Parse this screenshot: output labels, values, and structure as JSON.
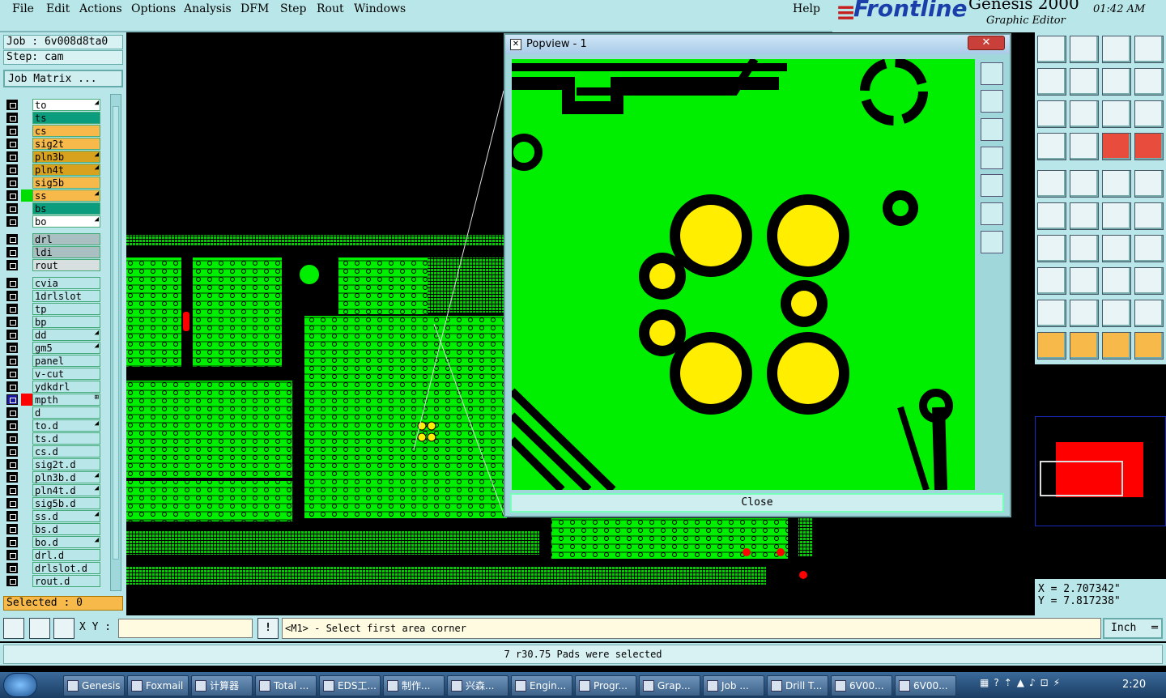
{
  "menubar": {
    "items": [
      "File",
      "Edit",
      "Actions",
      "Options",
      "Analysis",
      "DFM",
      "Step",
      "Rout",
      "Windows"
    ],
    "help": "Help"
  },
  "logo": {
    "brand": "Frontline",
    "product": "Genesis 2000",
    "subtitle": "Graphic Editor",
    "time": "01:42 AM"
  },
  "job": {
    "job_line": "Job : 6v008d8ta0",
    "step_line": "Step: cam",
    "matrix_button": "Job Matrix ..."
  },
  "layers": [
    {
      "name": "to",
      "color": "#ffffff",
      "flag": "◢"
    },
    {
      "name": "ts",
      "color": "#0a9c7c",
      "flag": ""
    },
    {
      "name": "cs",
      "color": "#f7b94a",
      "flag": ""
    },
    {
      "name": "sig2t",
      "color": "#f7b94a",
      "flag": ""
    },
    {
      "name": "pln3b",
      "color": "#d9a21e",
      "flag": "◢"
    },
    {
      "name": "pln4t",
      "color": "#d9a21e",
      "flag": "◢"
    },
    {
      "name": "sig5b",
      "color": "#f7b94a",
      "flag": ""
    },
    {
      "name": "ss",
      "color": "#f7b94a",
      "flag": "◢"
    },
    {
      "name": "bs",
      "color": "#0a9c7c",
      "flag": ""
    },
    {
      "name": "bo",
      "color": "#ffffff",
      "flag": "◢"
    },
    {
      "name": "drl",
      "color": "#a9bfc2",
      "flag": ""
    },
    {
      "name": "ldi",
      "color": "#a9bfc2",
      "flag": ""
    },
    {
      "name": "rout",
      "color": "#d7dfe0",
      "flag": ""
    },
    {
      "name": "cvia",
      "color": "#b9e6e8",
      "flag": ""
    },
    {
      "name": "1drlslot",
      "color": "#b9e6e8",
      "flag": ""
    },
    {
      "name": "tp",
      "color": "#b9e6e8",
      "flag": ""
    },
    {
      "name": "bp",
      "color": "#b9e6e8",
      "flag": ""
    },
    {
      "name": "dd",
      "color": "#b9e6e8",
      "flag": "◢"
    },
    {
      "name": "gm5",
      "color": "#b9e6e8",
      "flag": "◢"
    },
    {
      "name": "panel",
      "color": "#b9e6e8",
      "flag": ""
    },
    {
      "name": "v-cut",
      "color": "#b9e6e8",
      "flag": ""
    },
    {
      "name": "ydkdrl",
      "color": "#b9e6e8",
      "flag": ""
    },
    {
      "name": "mpth",
      "color": "#b9e6e8",
      "flag": "⊞"
    },
    {
      "name": "d",
      "color": "#b9e6e8",
      "flag": ""
    },
    {
      "name": "to.d",
      "color": "#b9e6e8",
      "flag": "◢"
    },
    {
      "name": "ts.d",
      "color": "#b9e6e8",
      "flag": ""
    },
    {
      "name": "cs.d",
      "color": "#b9e6e8",
      "flag": ""
    },
    {
      "name": "sig2t.d",
      "color": "#b9e6e8",
      "flag": ""
    },
    {
      "name": "pln3b.d",
      "color": "#b9e6e8",
      "flag": "◢"
    },
    {
      "name": "pln4t.d",
      "color": "#b9e6e8",
      "flag": "◢"
    },
    {
      "name": "sig5b.d",
      "color": "#b9e6e8",
      "flag": ""
    },
    {
      "name": "ss.d",
      "color": "#b9e6e8",
      "flag": "◢"
    },
    {
      "name": "bs.d",
      "color": "#b9e6e8",
      "flag": ""
    },
    {
      "name": "bo.d",
      "color": "#b9e6e8",
      "flag": "◢"
    },
    {
      "name": "drl.d",
      "color": "#b9e6e8",
      "flag": ""
    },
    {
      "name": "drlslot.d",
      "color": "#b9e6e8",
      "flag": ""
    },
    {
      "name": "rout.d",
      "color": "#b9e6e8",
      "flag": ""
    }
  ],
  "selected": "Selected : 0",
  "popview": {
    "title": "Popview - 1",
    "close_x": "✕",
    "close_button": "Close"
  },
  "coords": {
    "x": "X = 2.707342\"",
    "y": "Y = 7.817238\""
  },
  "cmdbar": {
    "xy_label": "X Y :",
    "xy_value": "",
    "prompt": "<M1> - Select first area corner",
    "units": "Inch"
  },
  "status": "7 r30.75 Pads were selected",
  "taskbar": {
    "tasks": [
      "Genesis",
      "Foxmail",
      "计算器",
      "Total ...",
      "EDS工...",
      "制作...",
      "兴森...",
      "Engin...",
      "Progr...",
      "Grap...",
      "Job ...",
      "Drill T...",
      "6V00...",
      "6V00..."
    ],
    "clock": "2:20"
  },
  "colors": {
    "panel_bg": "#b9e6e8",
    "copper": "#00ee00",
    "pad": "#ffee00",
    "highlight": "#ff0000"
  }
}
